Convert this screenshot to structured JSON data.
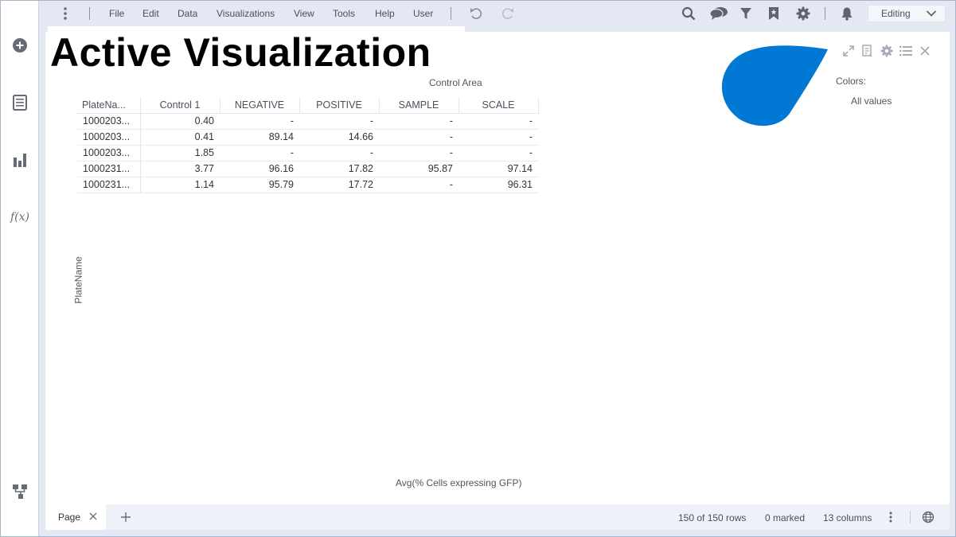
{
  "menu": {
    "items": [
      "File",
      "Edit",
      "Data",
      "Visualizations",
      "View",
      "Tools",
      "Help",
      "User"
    ]
  },
  "toolbar": {
    "mode_label": "Editing",
    "icons": [
      "more-vertical-icon",
      "undo-icon",
      "redo-icon",
      "search-icon",
      "collaboration-icon",
      "filter-icon",
      "bookmark-icon",
      "settings-icon",
      "notifications-icon",
      "chevron-down-icon"
    ]
  },
  "sidebar": {
    "icons": [
      "add-circle-icon",
      "data-table-icon",
      "bar-chart-icon",
      "function-icon",
      "data-canvas-icon"
    ],
    "fx_label": "f(x)"
  },
  "visualization": {
    "title": "Active Visualization",
    "column_axis_label": "Control Area",
    "row_axis_label": "PlateName",
    "value_axis_label": "Avg(% Cells expressing GFP)",
    "legend_title": "Colors:",
    "legend_value": "All values",
    "legend_color": "#0078d4",
    "table": {
      "columns": [
        "PlateNa...",
        "Control 1",
        "NEGATIVE",
        "POSITIVE",
        "SAMPLE",
        "SCALE"
      ],
      "rows": [
        [
          "1000203...",
          "0.40",
          "-",
          "-",
          "-",
          "-"
        ],
        [
          "1000203...",
          "0.41",
          "89.14",
          "14.66",
          "-",
          "-"
        ],
        [
          "1000203...",
          "1.85",
          "-",
          "-",
          "-",
          "-"
        ],
        [
          "1000231...",
          "3.77",
          "96.16",
          "17.82",
          "95.87",
          "97.14"
        ],
        [
          "1000231...",
          "1.14",
          "95.79",
          "17.72",
          "-",
          "96.31"
        ]
      ]
    },
    "controls": [
      "maximize-icon",
      "notes-icon",
      "settings-icon",
      "legend-list-icon",
      "close-icon"
    ]
  },
  "status": {
    "page_tab_label": "Page",
    "rows": "150 of 150 rows",
    "marked": "0 marked",
    "columns": "13 columns"
  }
}
